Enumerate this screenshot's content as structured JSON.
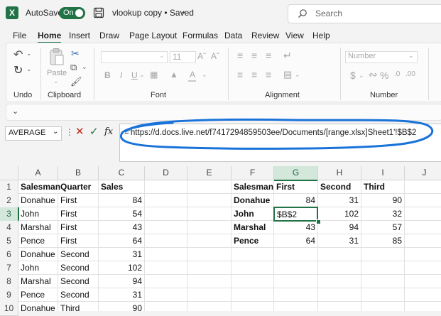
{
  "titlebar": {
    "autosave_label": "AutoSave",
    "autosave_state": "On",
    "filename": "vlookup copy • Saved",
    "search_placeholder": "Search"
  },
  "tabs": [
    "File",
    "Home",
    "Insert",
    "Draw",
    "Page Layout",
    "Formulas",
    "Data",
    "Review",
    "View",
    "Help"
  ],
  "ribbon": {
    "groups": [
      "Undo",
      "Clipboard",
      "Font",
      "Alignment",
      "Number"
    ],
    "paste_label": "Paste",
    "font_size": "11",
    "number_format": "Number",
    "percent_symbol": "%",
    "currency_symbol": "$"
  },
  "formula_bar": {
    "name_box": "AVERAGE",
    "fx": "fx",
    "formula": "='https://d.docs.live.net/f7417294859503ee/Documents/[range.xlsx]Sheet1'!$B$2"
  },
  "grid": {
    "columns": [
      "A",
      "B",
      "C",
      "D",
      "E",
      "F",
      "G",
      "H",
      "I",
      "J"
    ],
    "selected_column": "G",
    "selected_row": "3",
    "rows": [
      "1",
      "2",
      "3",
      "4",
      "5",
      "6",
      "7",
      "8",
      "9",
      "10"
    ],
    "table1": {
      "headers": [
        "Salesman",
        "Quarter",
        "Sales"
      ],
      "rows": [
        [
          "Donahue",
          "First",
          "84"
        ],
        [
          "John",
          "First",
          "54"
        ],
        [
          "Marshal",
          "First",
          "43"
        ],
        [
          "Pence",
          "First",
          "64"
        ],
        [
          "Donahue",
          "Second",
          "31"
        ],
        [
          "John",
          "Second",
          "102"
        ],
        [
          "Marshal",
          "Second",
          "94"
        ],
        [
          "Pence",
          "Second",
          "31"
        ],
        [
          "Donahue",
          "Third",
          "90"
        ]
      ]
    },
    "table2": {
      "headers": [
        "Salesman",
        "First",
        "Second",
        "Third"
      ],
      "rows": [
        [
          "Donahue",
          "84",
          "31",
          "90"
        ],
        [
          "John",
          "$B$2",
          "102",
          "32"
        ],
        [
          "Marshal",
          "43",
          "94",
          "57"
        ],
        [
          "Pence",
          "64",
          "31",
          "85"
        ]
      ]
    }
  },
  "colors": {
    "accent": "#217346",
    "annotation": "#1a73d9"
  }
}
